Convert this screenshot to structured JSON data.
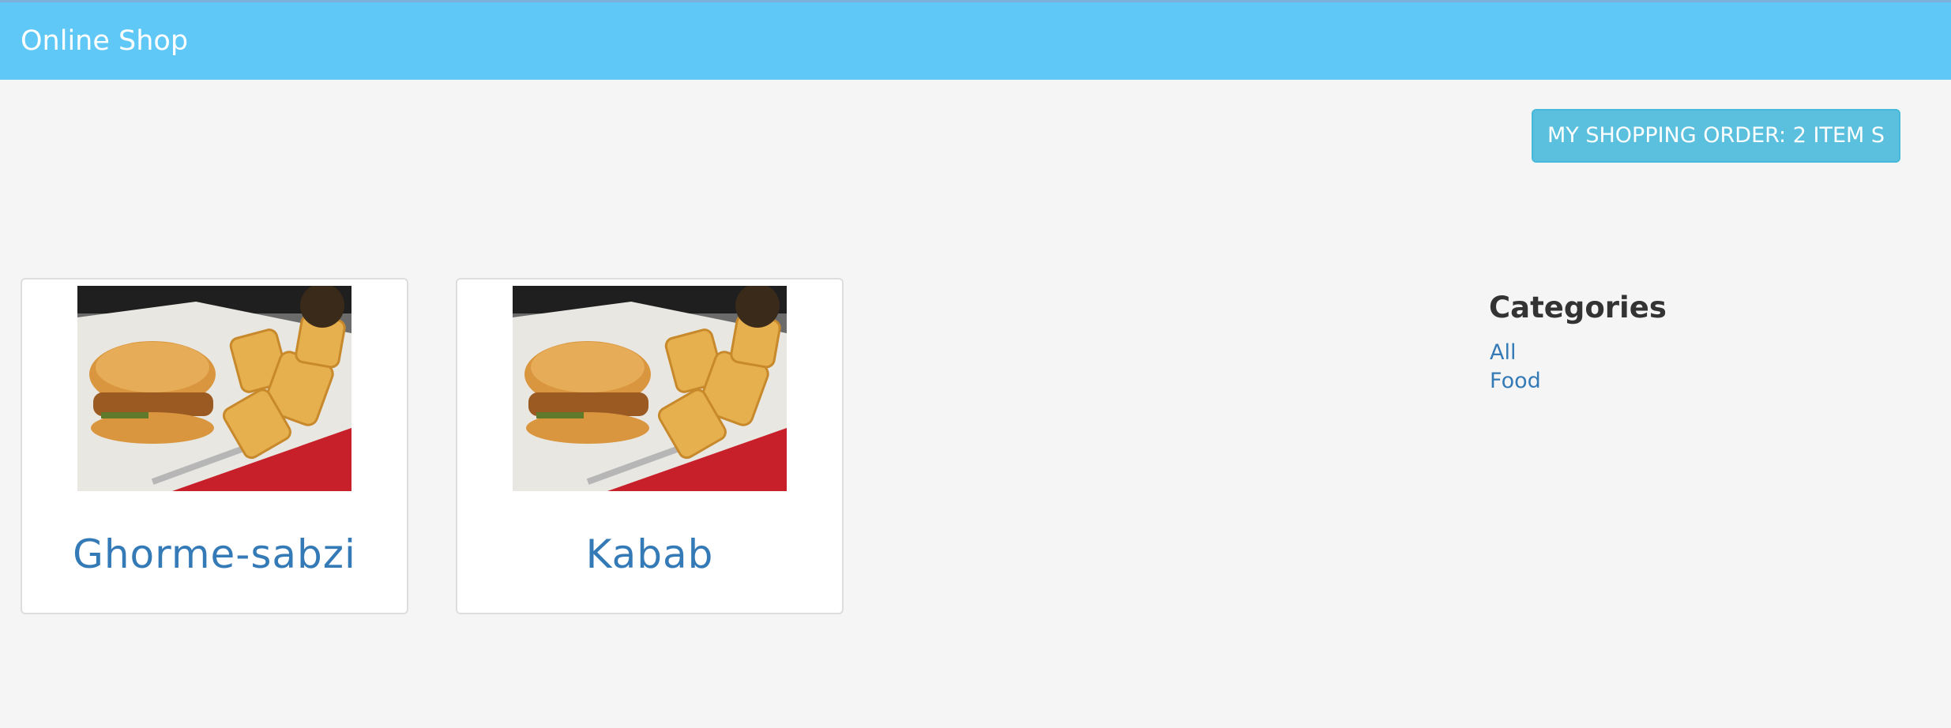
{
  "navbar": {
    "brand": "Online Shop"
  },
  "cart": {
    "label": "MY SHOPPING ORDER: 2 ITEM S"
  },
  "products": [
    {
      "name": "Ghorme-sabzi"
    },
    {
      "name": "Kabab"
    }
  ],
  "sidebar": {
    "title": "Categories",
    "categories": [
      {
        "label": "All"
      },
      {
        "label": "Food"
      }
    ]
  },
  "colors": {
    "navbar": "#5fc8f7",
    "button": "#5bc0de",
    "link": "#337ab7",
    "background": "#f5f5f5"
  }
}
